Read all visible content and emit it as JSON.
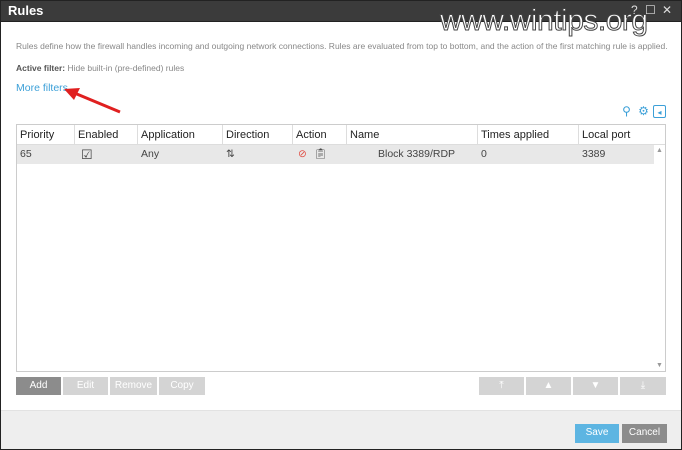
{
  "window": {
    "title": "Rules",
    "help": "?",
    "maximize": "☐",
    "close": "✕"
  },
  "watermark": "www.wintips.org",
  "description": "Rules define how the firewall handles incoming and outgoing network connections. Rules are evaluated from top to bottom, and the action of the first matching rule is applied.",
  "active_filter": {
    "label": "Active filter:",
    "value": "Hide built-in (pre-defined) rules"
  },
  "more_filters": "More filters",
  "table": {
    "columns": [
      "Priority",
      "Enabled",
      "Application",
      "Direction",
      "Action",
      "Name",
      "Times applied",
      "Local port"
    ],
    "rows": [
      {
        "priority": "65",
        "enabled": true,
        "enabled_glyph": "☑",
        "application": "Any",
        "direction": "⇅",
        "action": "block",
        "name": "Block 3389/RDP",
        "times_applied": "0",
        "local_port": "3389"
      }
    ]
  },
  "buttons": {
    "add": "Add",
    "edit": "Edit",
    "remove": "Remove",
    "copy": "Copy",
    "top": "⤒",
    "up": "▲",
    "down": "▼",
    "bottom": "⤓",
    "save": "Save",
    "cancel": "Cancel"
  },
  "colors": {
    "accent": "#3ca0d8",
    "block": "#e0534a",
    "annotation_arrow": "#e02020"
  }
}
